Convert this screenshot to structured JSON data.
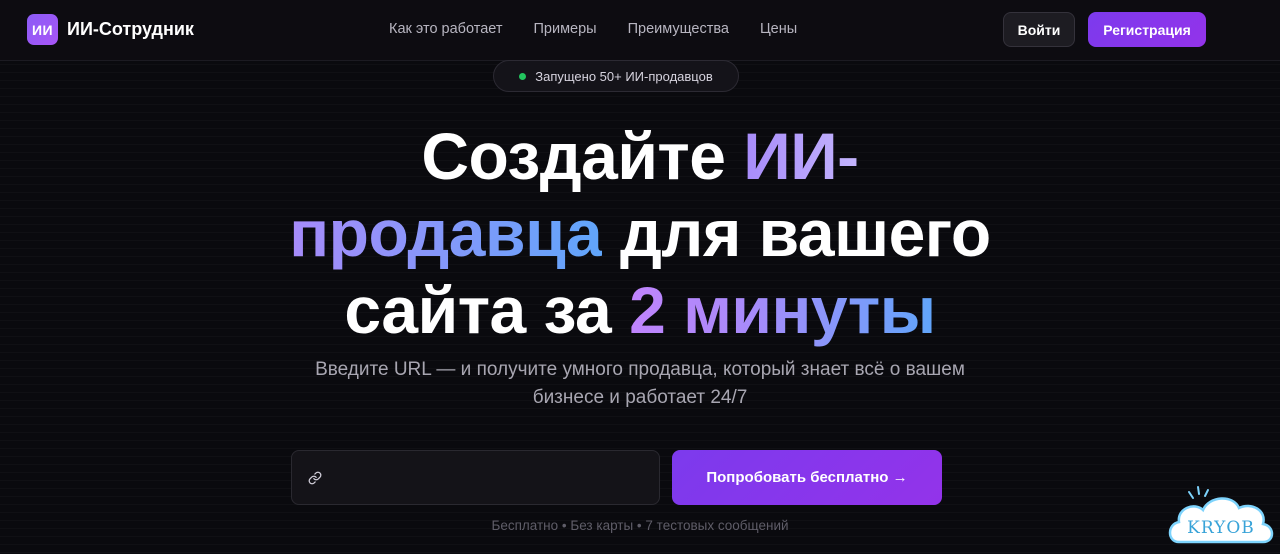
{
  "brand": {
    "logo_badge": "ИИ",
    "name": "ИИ-Сотрудник"
  },
  "nav": {
    "items": [
      "Как это работает",
      "Примеры",
      "Преимущества",
      "Цены"
    ]
  },
  "auth": {
    "login_label": "Войти",
    "register_label": "Регистрация"
  },
  "hero": {
    "badge_text": "Запущено 50+ ИИ-продавцов",
    "headline": {
      "part1": "Создайте ",
      "part2": "ИИ-",
      "part3": "продавца",
      "part4": " для вашего",
      "part5": "сайта за ",
      "part6": "2 минуты"
    },
    "subtitle": "Введите URL — и получите умного продавца, который знает всё о вашем бизнесе и работает 24/7",
    "url_input": {
      "value": "",
      "placeholder": ""
    },
    "cta_label": "Попробовать бесплатно →",
    "footnote": "Бесплатно • Без карты • 7 тестовых сообщений"
  },
  "watermark_text": "KRYOB",
  "colors": {
    "accent": "#7c3aed",
    "accent_light": "#a78bfa",
    "gradient_blue": "#60a5fa",
    "status_green": "#22c55e",
    "background": "#0a0a0e"
  },
  "icons": {
    "input_icon": "link-icon",
    "badge_dot": "status-dot"
  }
}
